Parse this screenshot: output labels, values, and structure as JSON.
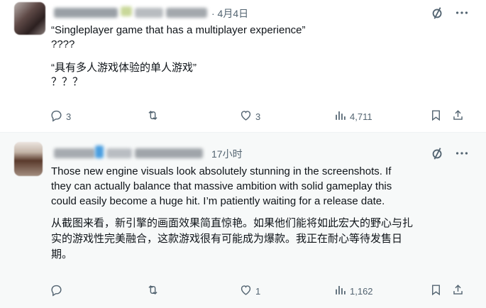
{
  "posts": [
    {
      "time": "4月4日",
      "text_en": "“Singleplayer game that has a multiplayer experience”\n????",
      "text_zh": "“具有多人游戏体验的单人游戏”\n？？？",
      "stats": {
        "replies": "3",
        "reposts": "",
        "likes": "3",
        "views": "4,711"
      }
    },
    {
      "time": "17小时",
      "text_en": "Those new engine visuals look absolutely stunning in the screenshots. If\nthey can actually balance that massive ambition with solid gameplay this\ncould easily become a huge hit. I’m patiently waiting for a release date.",
      "text_zh": "从截图来看，新引擎的画面效果简直惊艳。如果他们能将如此宏大的野心与扎\n实的游戏性完美融合，这款游戏很有可能成为爆款。我正在耐心等待发售日\n期。",
      "stats": {
        "replies": "",
        "reposts": "",
        "likes": "1",
        "views": "1,162"
      }
    }
  ],
  "icons": [
    "grok-icon",
    "more-icon",
    "reply-icon",
    "repost-icon",
    "like-icon",
    "views-icon",
    "bookmark-icon",
    "share-icon"
  ],
  "colors": {
    "text": "#0f1419",
    "secondary": "#536471",
    "divider": "#eff3f4",
    "highlight_bg": "#f7f9f9"
  }
}
